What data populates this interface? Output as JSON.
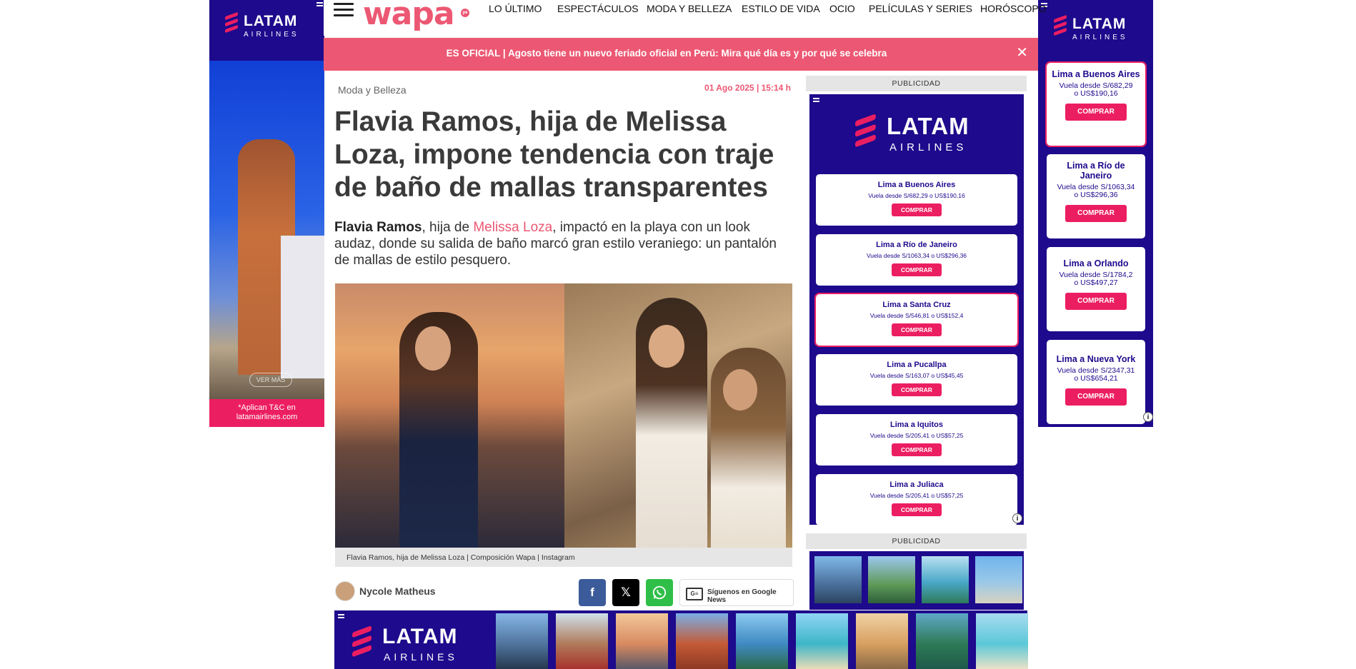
{
  "site": {
    "logo": "wapa",
    "logo_badge": "pe",
    "brand_color": "#ec5873"
  },
  "nav": {
    "menu_icon": "hamburger-menu-icon",
    "items": [
      "LO ÚLTIMO",
      "ESPECTÁCULOS",
      "MODA Y BELLEZA",
      "ESTILO DE VIDA",
      "OCIO",
      "PELÍCULAS Y SERIES",
      "HORÓSCOPO"
    ]
  },
  "breaking": {
    "text": "ES OFICIAL | Agosto tiene un nuevo feriado oficial en Perú: Mira qué día es y por qué se celebra",
    "close": "✕"
  },
  "article": {
    "section": "Moda y Belleza",
    "date": "01 Ago 2025 | 15:14 h",
    "title": "Flavia Ramos, hija de Melissa Loza, impone tendencia con traje de baño de mallas transparentes",
    "lead_bold": "Flavia Ramos",
    "lead_1": ", hija de ",
    "lead_link": "Melissa Loza",
    "lead_2": ", impactó en la playa con un look audaz, donde su salida de baño marcó gran estilo veraniego: un pantalón de mallas de estilo pesquero.",
    "caption": "Flavia Ramos, hija de Melissa Loza | Composición Wapa | Instagram",
    "author": "Nycole Matheus",
    "google_news": "Síguenos en Google News"
  },
  "ads": {
    "publicidad_label": "PUBLICIDAD",
    "brand_word": "LATAM",
    "brand_sub": "AIRLINES",
    "skin_left_cta": "VER MÁS",
    "skin_left_footer": "*Aplican T&C en latamairlines.com",
    "buy_label": "COMPRAR",
    "price_prefix": "Vuela desde S/",
    "usd_prefix": "o US$",
    "sidebar_offers": [
      {
        "route": "Lima a Buenos Aires",
        "pen": "682,29",
        "usd": "190,16"
      },
      {
        "route": "Lima a Río de Janeiro",
        "pen": "1063,34",
        "usd": "296,36"
      },
      {
        "route": "Lima a Santa Cruz",
        "pen": "546,81",
        "usd": "152,4"
      },
      {
        "route": "Lima a Pucallpa",
        "pen": "163,07",
        "usd": "45,45"
      },
      {
        "route": "Lima a Iquitos",
        "pen": "205,41",
        "usd": "57,25"
      },
      {
        "route": "Lima a Juliaca",
        "pen": "205,41",
        "usd": "57,25"
      }
    ],
    "skin_right_offers": [
      {
        "route": "Lima a Buenos Aires",
        "pen": "682,29",
        "usd": "190,16"
      },
      {
        "route": "Lima a Río de Janeiro",
        "pen": "1063,34",
        "usd": "296,36"
      },
      {
        "route": "Lima a Orlando",
        "pen": "1784,2",
        "usd": "497,27"
      },
      {
        "route": "Lima a Nueva York",
        "pen": "2347,31",
        "usd": "654,21"
      }
    ],
    "colors": {
      "latam_blue": "#1d0a8c",
      "latam_pink": "#ec1e62"
    }
  }
}
